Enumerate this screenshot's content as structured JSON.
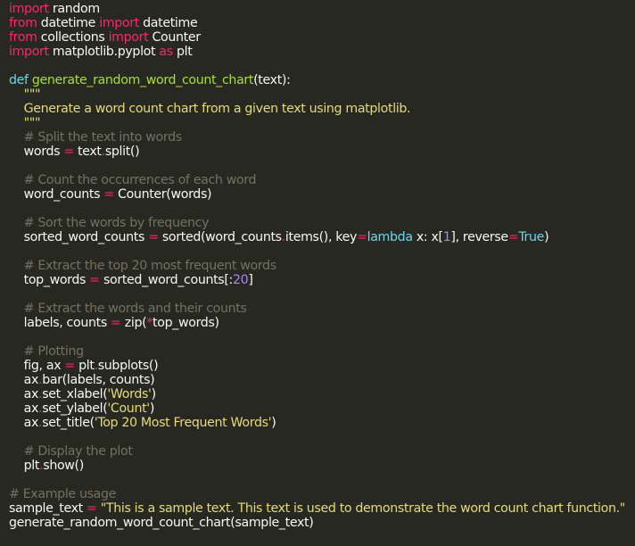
{
  "theme": {
    "background": "#272822",
    "plain": "#f8f8f2",
    "keyword": "#f92672",
    "function": "#a6e22e",
    "string": "#e6db74",
    "comment": "#75715e",
    "number": "#ae81ff",
    "builtin": "#66d9ef"
  },
  "code": [
    [
      [
        "kw",
        "import"
      ],
      [
        "pl",
        " random"
      ]
    ],
    [
      [
        "kw",
        "from"
      ],
      [
        "pl",
        " datetime "
      ],
      [
        "kw",
        "import"
      ],
      [
        "pl",
        " datetime"
      ]
    ],
    [
      [
        "kw",
        "from"
      ],
      [
        "pl",
        " collections "
      ],
      [
        "kw",
        "import"
      ],
      [
        "pl",
        " Counter"
      ]
    ],
    [
      [
        "kw",
        "import"
      ],
      [
        "pl",
        " matplotlib.pyplot "
      ],
      [
        "kw",
        "as"
      ],
      [
        "pl",
        " plt"
      ]
    ],
    [],
    [
      [
        "bi",
        "def"
      ],
      [
        "pl",
        " "
      ],
      [
        "fn",
        "generate_random_word_count_chart"
      ],
      [
        "pl",
        "(text):"
      ]
    ],
    [
      [
        "str",
        "    \"\"\""
      ]
    ],
    [
      [
        "str",
        "    Generate a word count chart from a given text using matplotlib."
      ]
    ],
    [
      [
        "str",
        "    \"\"\""
      ]
    ],
    [
      [
        "cm",
        "    # Split the text into words"
      ]
    ],
    [
      [
        "pl",
        "    words "
      ],
      [
        "op",
        "="
      ],
      [
        "pl",
        " text"
      ],
      [
        "op",
        "."
      ],
      [
        "pl",
        "split()"
      ]
    ],
    [],
    [
      [
        "cm",
        "    # Count the occurrences of each word"
      ]
    ],
    [
      [
        "pl",
        "    word_counts "
      ],
      [
        "op",
        "="
      ],
      [
        "pl",
        " Counter(words)"
      ]
    ],
    [],
    [
      [
        "cm",
        "    # Sort the words by frequency"
      ]
    ],
    [
      [
        "pl",
        "    sorted_word_counts "
      ],
      [
        "op",
        "="
      ],
      [
        "pl",
        " sorted(word_counts"
      ],
      [
        "op",
        "."
      ],
      [
        "pl",
        "items(), key"
      ],
      [
        "op",
        "="
      ],
      [
        "bi",
        "lambda"
      ],
      [
        "pl",
        " x: x["
      ],
      [
        "num",
        "1"
      ],
      [
        "pl",
        "], reverse"
      ],
      [
        "op",
        "="
      ],
      [
        "bi",
        "True"
      ],
      [
        "pl",
        ")"
      ]
    ],
    [],
    [
      [
        "cm",
        "    # Extract the top 20 most frequent words"
      ]
    ],
    [
      [
        "pl",
        "    top_words "
      ],
      [
        "op",
        "="
      ],
      [
        "pl",
        " sorted_word_counts[:"
      ],
      [
        "num",
        "20"
      ],
      [
        "pl",
        "]"
      ]
    ],
    [],
    [
      [
        "cm",
        "    # Extract the words and their counts"
      ]
    ],
    [
      [
        "pl",
        "    labels, counts "
      ],
      [
        "op",
        "="
      ],
      [
        "pl",
        " zip("
      ],
      [
        "op",
        "*"
      ],
      [
        "pl",
        "top_words)"
      ]
    ],
    [],
    [
      [
        "cm",
        "    # Plotting"
      ]
    ],
    [
      [
        "pl",
        "    fig, ax "
      ],
      [
        "op",
        "="
      ],
      [
        "pl",
        " plt"
      ],
      [
        "op",
        "."
      ],
      [
        "pl",
        "subplots()"
      ]
    ],
    [
      [
        "pl",
        "    ax"
      ],
      [
        "op",
        "."
      ],
      [
        "pl",
        "bar(labels, counts)"
      ]
    ],
    [
      [
        "pl",
        "    ax"
      ],
      [
        "op",
        "."
      ],
      [
        "pl",
        "set_xlabel("
      ],
      [
        "str",
        "'Words'"
      ],
      [
        "pl",
        ")"
      ]
    ],
    [
      [
        "pl",
        "    ax"
      ],
      [
        "op",
        "."
      ],
      [
        "pl",
        "set_ylabel("
      ],
      [
        "str",
        "'Count'"
      ],
      [
        "pl",
        ")"
      ]
    ],
    [
      [
        "pl",
        "    ax"
      ],
      [
        "op",
        "."
      ],
      [
        "pl",
        "set_title("
      ],
      [
        "str",
        "'Top 20 Most Frequent Words'"
      ],
      [
        "pl",
        ")"
      ]
    ],
    [],
    [
      [
        "cm",
        "    # Display the plot"
      ]
    ],
    [
      [
        "pl",
        "    plt"
      ],
      [
        "op",
        "."
      ],
      [
        "pl",
        "show()"
      ]
    ],
    [],
    [
      [
        "cm",
        "# Example usage"
      ]
    ],
    [
      [
        "pl",
        "sample_text "
      ],
      [
        "op",
        "="
      ],
      [
        "pl",
        " "
      ],
      [
        "str",
        "\"This is a sample text. This text is used to demonstrate the word count chart function.\""
      ]
    ],
    [
      [
        "pl",
        "generate_random_word_count_chart(sample_text)"
      ]
    ]
  ]
}
